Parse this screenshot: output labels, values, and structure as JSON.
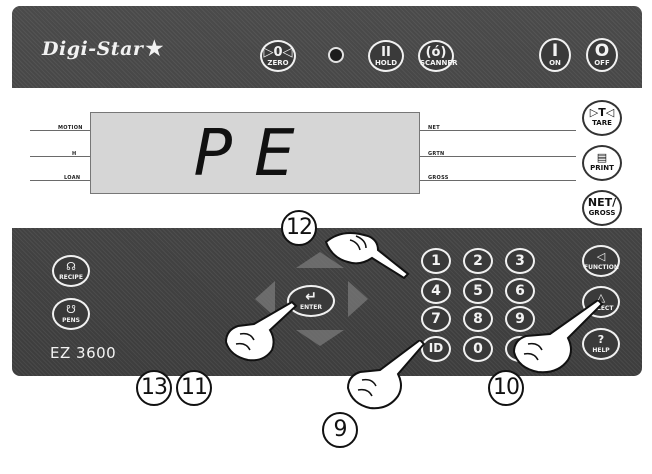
{
  "brand": {
    "name": "Digi-Star"
  },
  "top_buttons": {
    "zero": {
      "symbol": "▷0◁",
      "label": "ZERO"
    },
    "hold": {
      "symbol": "II",
      "label": "HOLD"
    },
    "scanner": {
      "symbol": "(ó)",
      "label": "SCANNER"
    },
    "on": {
      "symbol": "I",
      "label": "ON"
    },
    "off": {
      "symbol": "O",
      "label": "OFF"
    }
  },
  "display": {
    "text": "PE",
    "left_labels": [
      "MOTION",
      "H",
      "LOAN"
    ],
    "right_labels": [
      "NET",
      "GRTN",
      "GROSS"
    ]
  },
  "right_buttons": {
    "tare": {
      "symbol": "▷T◁",
      "label": "TARE"
    },
    "print": {
      "symbol": "▤",
      "label": "PRINT"
    },
    "net_gross": {
      "symbol": "NET/",
      "label": "GROSS"
    }
  },
  "keypad": {
    "keys": [
      "1",
      "2",
      "3",
      "4",
      "5",
      "6",
      "7",
      "8",
      "9",
      "ID",
      "0",
      ""
    ]
  },
  "function_buttons": {
    "function": {
      "symbol": "◁",
      "label": "FUNCTION"
    },
    "select": {
      "symbol": "△",
      "label": "SELECT"
    },
    "help": {
      "symbol": "?",
      "label": "HELP"
    },
    "recipe": {
      "symbol": "☊",
      "label": "RECIPE"
    },
    "pens": {
      "symbol": "☋",
      "label": "PENS"
    },
    "enter": {
      "symbol": "↵",
      "label": "ENTER"
    }
  },
  "model": "EZ 3600",
  "callouts": {
    "c9": "9",
    "c10": "10",
    "c11": "11",
    "c12": "12",
    "c13": "13"
  },
  "colors": {
    "panel": "#424242",
    "display": "#d6d6d6"
  }
}
